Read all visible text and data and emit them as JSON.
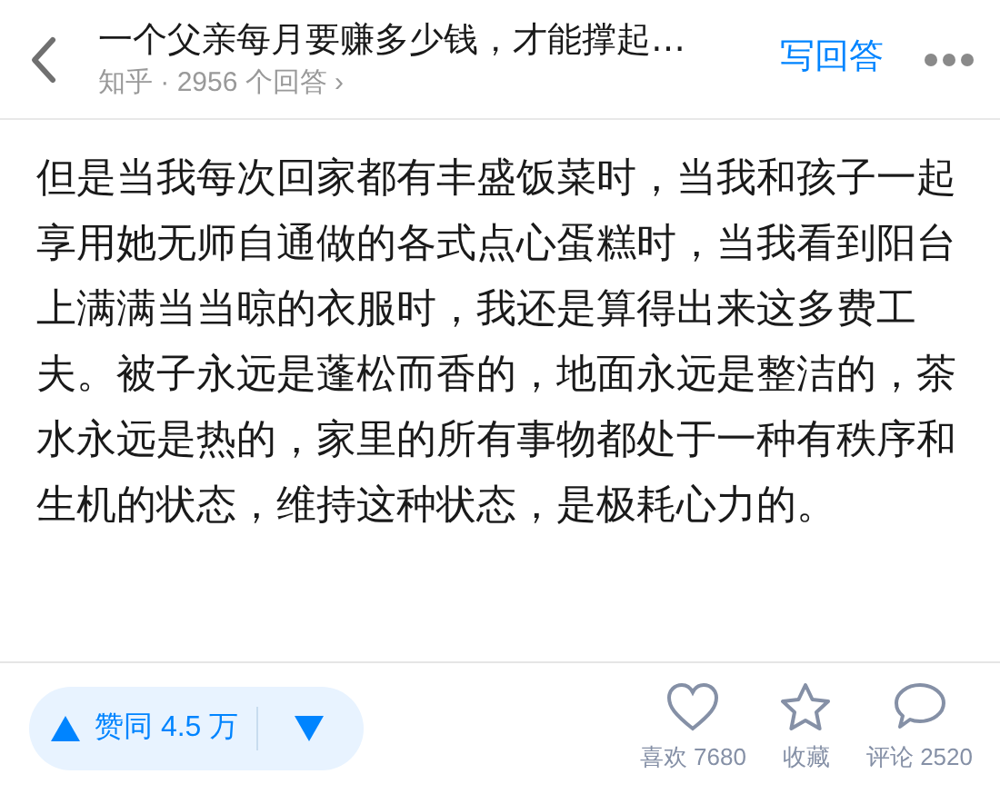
{
  "header": {
    "title": "一个父亲每月要赚多少钱，才能撑起…",
    "subtitle": "知乎 · 2956 个回答 ›",
    "write_answer": "写回答"
  },
  "answer": {
    "text": "但是当我每次回家都有丰盛饭菜时，当我和孩子一起享用她无师自通做的各式点心蛋糕时，当我看到阳台上满满当当晾的衣服时，我还是算得出来这多费工夫。被子永远是蓬松而香的，地面永远是整洁的，茶水永远是热的，家里的所有事物都处于一种有秩序和生机的状态，维持这种状态，是极耗心力的。"
  },
  "bottom_bar": {
    "upvote": "赞同 4.5 万",
    "actions": [
      {
        "kind": "like",
        "label": "喜欢 7680"
      },
      {
        "kind": "favorite",
        "label": "收藏"
      },
      {
        "kind": "comment",
        "label": "评论 2520"
      }
    ]
  }
}
